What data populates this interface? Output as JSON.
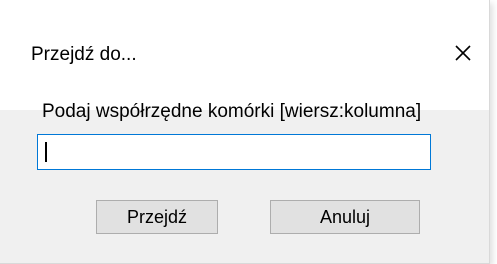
{
  "dialog": {
    "title": "Przejdź do...",
    "close_icon": "close-icon",
    "prompt": "Podaj współrzędne komórki [wiersz:kolumna]",
    "input_value": "",
    "ok_label": "Przejdź",
    "cancel_label": "Anuluj"
  },
  "colors": {
    "input_focus_border": "#0078d7",
    "button_face": "#e1e1e1",
    "dialog_background": "#f0f0f0"
  }
}
